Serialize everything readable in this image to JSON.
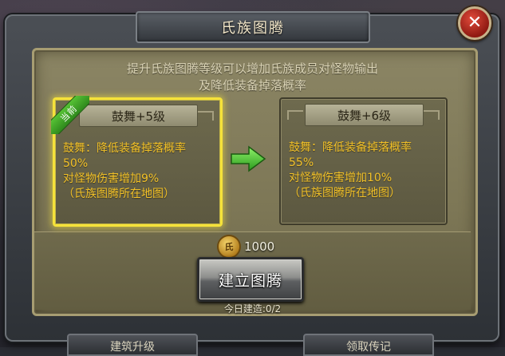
{
  "window": {
    "title": "氏族图腾",
    "close_label": "✕"
  },
  "description": {
    "line1": "提升氏族图腾等级可以增加氏族成员对怪物输出",
    "line2": "及降低装备掉落概率"
  },
  "current_level": {
    "badge": "当前",
    "title": "鼓舞+5级",
    "line1": "鼓舞：降低装备掉落概率",
    "line2": "50%",
    "line3": "对怪物伤害增加9%",
    "line4": "（氏族图腾所在地图）"
  },
  "next_level": {
    "title": "鼓舞+6级",
    "line1": "鼓舞：降低装备掉落概率",
    "line2": "55%",
    "line3": "对怪物伤害增加10%",
    "line4": "（氏族图腾所在地图）"
  },
  "cost": {
    "coin_glyph": "氏",
    "amount": "1000"
  },
  "build_button": {
    "label": "建立图腾"
  },
  "daily_count": {
    "text": "今日建造:0/2"
  },
  "bottom_tabs": [
    {
      "label": "建筑升级"
    },
    {
      "label": "领取传记"
    }
  ],
  "colors": {
    "highlight": "#f5e23a",
    "body_text": "#f1c027",
    "ribbon": "#3fa52a",
    "arrow": "#4fd33a"
  }
}
